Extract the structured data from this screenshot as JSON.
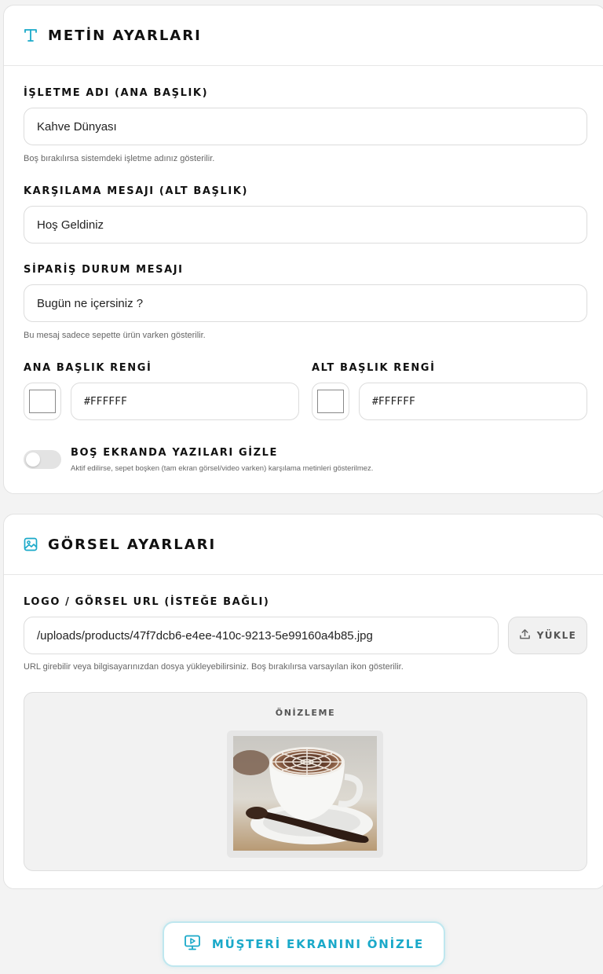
{
  "colors": {
    "accent": "#1aa9c9"
  },
  "text_settings": {
    "title": "METİN AYARLARI",
    "icon": "text-icon",
    "business_name": {
      "label": "İŞLETME ADI (ANA BAŞLIK)",
      "value": "Kahve Dünyası",
      "help": "Boş bırakılırsa sistemdeki işletme adınız gösterilir."
    },
    "welcome_message": {
      "label": "KARŞILAMA MESAJI (ALT BAŞLIK)",
      "value": "Hoş Geldiniz"
    },
    "order_status": {
      "label": "SİPARİŞ DURUM MESAJI",
      "value": "Bugün ne içersiniz ?",
      "help": "Bu mesaj sadece sepette ürün varken gösterilir."
    },
    "title_color": {
      "label": "ANA BAŞLIK RENGİ",
      "value": "#FFFFFF"
    },
    "subtitle_color": {
      "label": "ALT BAŞLIK RENGİ",
      "value": "#FFFFFF"
    },
    "hide_text_toggle": {
      "label": "BOŞ EKRANDA YAZILARI GİZLE",
      "help": "Aktif edilirse, sepet boşken (tam ekran görsel/video varken) karşılama metinleri gösterilmez.",
      "enabled": false
    }
  },
  "image_settings": {
    "title": "GÖRSEL AYARLARI",
    "icon": "image-icon",
    "logo_url": {
      "label": "LOGO / GÖRSEL URL (İSTEĞE BAĞLI)",
      "value": "/uploads/products/47f7dcb6-e4ee-410c-9213-5e99160a4b85.jpg",
      "help": "URL girebilir veya bilgisayarınızdan dosya yükleyebilirsiniz. Boş bırakılırsa varsayılan ikon gösterilir."
    },
    "upload_button": "YÜKLE",
    "preview_label": "ÖNİZLEME"
  },
  "preview_customer_button": "MÜŞTERİ EKRANINI ÖNİZLE"
}
